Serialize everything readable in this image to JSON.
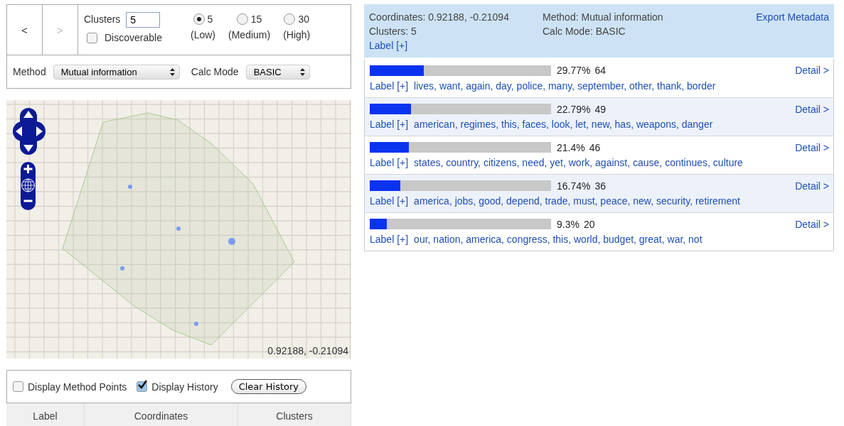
{
  "nav": {
    "back": "<",
    "forward": ">",
    "forward_disabled": true
  },
  "clusters": {
    "label": "Clusters",
    "value": "5",
    "discoverable_label": "Discoverable",
    "discoverable": false
  },
  "granularity": [
    {
      "value": "5",
      "label": "(Low)",
      "selected": true
    },
    {
      "value": "15",
      "label": "(Medium)",
      "selected": false
    },
    {
      "value": "30",
      "label": "(High)",
      "selected": false
    }
  ],
  "method": {
    "label": "Method",
    "value": "Mutual information"
  },
  "calc_mode": {
    "label": "Calc Mode",
    "value": "BASIC"
  },
  "map": {
    "coordinates": "0.92188, -0.21094"
  },
  "history": {
    "options": [
      {
        "label": "Display Method Points",
        "checked": false
      },
      {
        "label": "Display History",
        "checked": true
      }
    ],
    "clear_button": "Clear History",
    "columns": [
      "Label",
      "Coordinates",
      "Clusters"
    ]
  },
  "summary": {
    "coordinates": "Coordinates: 0.92188, -0.21094",
    "clusters": "Clusters: 5",
    "label_link": "Label [+]",
    "method": "Method: Mutual information",
    "calc_mode": "Calc Mode: BASIC",
    "export": "Export Metadata"
  },
  "cluster_rows": [
    {
      "level": 0.2977,
      "percent": "29.77%",
      "count": "64",
      "detail": "Detail >",
      "label_link": "Label [+]",
      "terms": "lives, want, again, day, police, many, september, other, thank, border"
    },
    {
      "level": 0.2279,
      "percent": "22.79%",
      "count": "49",
      "detail": "Detail >",
      "label_link": "Label [+]",
      "terms": "american, regimes, this, faces, look, let, new, has, weapons, danger"
    },
    {
      "level": 0.214,
      "percent": "21.4%",
      "count": "46",
      "detail": "Detail >",
      "label_link": "Label [+]",
      "terms": "states, country, citizens, need, yet, work, against, cause, continues, culture"
    },
    {
      "level": 0.1674,
      "percent": "16.74%",
      "count": "36",
      "detail": "Detail >",
      "label_link": "Label [+]",
      "terms": "america, jobs, good, depend, trade, must, peace, new, security, retirement"
    },
    {
      "level": 0.093,
      "percent": "9.3%",
      "count": "20",
      "detail": "Detail >",
      "label_link": "Label [+]",
      "terms": "our, nation, america, congress, this, world, budget, great, war, not"
    }
  ]
}
